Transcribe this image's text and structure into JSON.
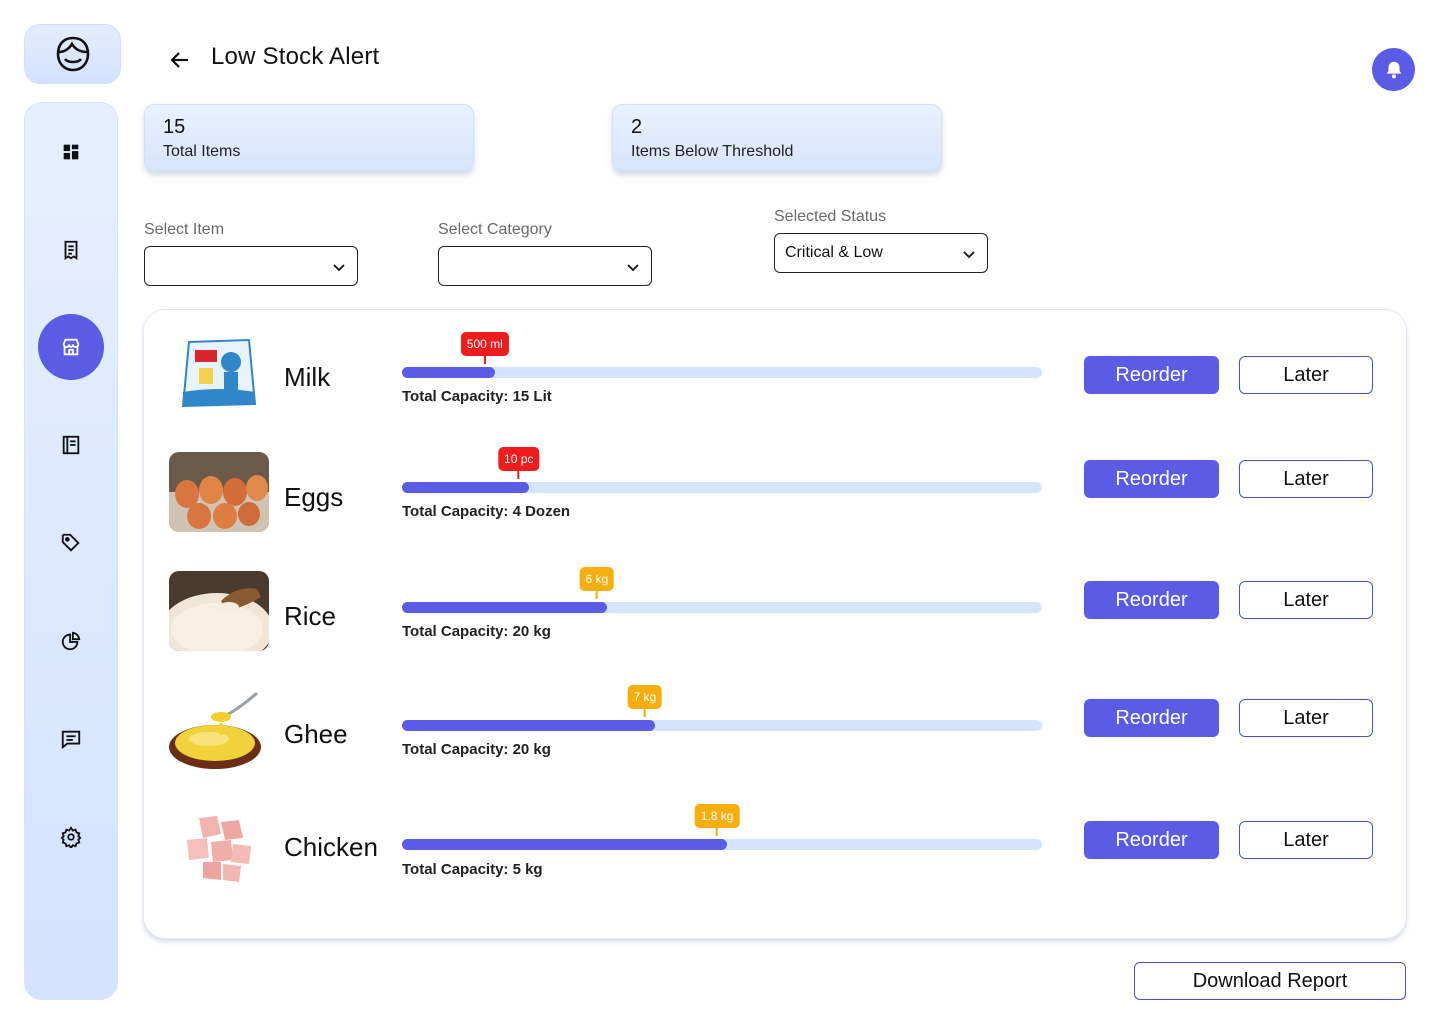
{
  "header": {
    "title": "Low Stock Alert"
  },
  "stats": [
    {
      "value": "15",
      "label": "Total Items"
    },
    {
      "value": "2",
      "label": "Items Below Threshold"
    }
  ],
  "filters": {
    "item": {
      "label": "Select Item",
      "value": ""
    },
    "category": {
      "label": "Select Category",
      "value": ""
    },
    "status": {
      "label": "Selected Status",
      "value": "Critical & Low"
    }
  },
  "items": [
    {
      "name": "Milk",
      "level": "500 ml",
      "capacity": "Total Capacity: 15 Lit",
      "fill_fraction": 0.145,
      "severity": "critical"
    },
    {
      "name": "Eggs",
      "level": "10 pc",
      "capacity": "Total Capacity: 4 Dozen",
      "fill_fraction": 0.198,
      "severity": "critical"
    },
    {
      "name": "Rice",
      "level": "6 kg",
      "capacity": "Total Capacity: 20 kg",
      "fill_fraction": 0.32,
      "severity": "low"
    },
    {
      "name": "Ghee",
      "level": "7 kg",
      "capacity": "Total Capacity: 20 kg",
      "fill_fraction": 0.395,
      "severity": "low"
    },
    {
      "name": "Chicken",
      "level": "1.8 kg",
      "capacity": "Total Capacity: 5 kg",
      "fill_fraction": 0.508,
      "severity": "low"
    }
  ],
  "actions": {
    "reorder_label": "Reorder",
    "later_label": "Later",
    "download_label": "Download Report"
  },
  "colors": {
    "accent": "#5a5ce6",
    "critical": "#ee1c1c",
    "low": "#f5ae0c",
    "track": "#d4e4fb"
  },
  "icons": [
    "logo-face-icon",
    "dashboard-icon",
    "receipt-icon",
    "store-icon",
    "ledger-icon",
    "tag-icon",
    "pie-chart-icon",
    "message-icon",
    "settings-icon",
    "back-arrow-icon",
    "bell-icon"
  ]
}
